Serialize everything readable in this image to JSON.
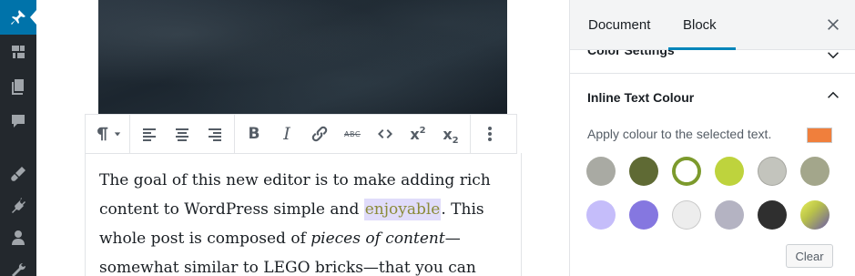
{
  "admin_menu": {
    "items": [
      {
        "icon": "pin-icon",
        "active": true
      },
      {
        "icon": "media-icon",
        "active": false
      },
      {
        "icon": "pages-icon",
        "active": false
      },
      {
        "icon": "comments-icon",
        "active": false
      },
      {
        "icon": "appearance-icon",
        "active": false
      },
      {
        "icon": "plugins-icon",
        "active": false
      },
      {
        "icon": "users-icon",
        "active": false
      },
      {
        "icon": "tools-icon",
        "active": false
      }
    ]
  },
  "toolbar": {
    "paragraph_icon": "paragraph-icon",
    "buttons": [
      "align-left-icon",
      "align-center-icon",
      "align-right-icon",
      "bold-icon",
      "italic-icon",
      "link-icon",
      "strikethrough-icon",
      "code-icon",
      "superscript-icon",
      "subscript-icon",
      "more-icon"
    ],
    "bold_glyph": "B",
    "italic_glyph": "I",
    "strike_glyph": "ABC",
    "sup_glyph": "x",
    "sup_small": "2",
    "sub_glyph": "x",
    "sub_small": "2"
  },
  "content": {
    "line1_a": "The goal of this new editor is to make adding rich content to WordPress simple and ",
    "highlighted": "enjoyable",
    "line1_b": ". This whole post is composed of ",
    "italic": "pieces of content",
    "line1_c": "—somewhat similar to LEGO bricks—that you can"
  },
  "settings": {
    "tab_document": "Document",
    "tab_block": "Block",
    "collapsed_panel_title": "Color Settings",
    "panel_title": "Inline Text Colour",
    "apply_label": "Apply colour to the selected text.",
    "current_color": "#f07f3c",
    "swatches": [
      {
        "color": "#a9aaa3",
        "selected": false
      },
      {
        "color": "#5f6a34",
        "selected": false
      },
      {
        "color": "#7c9a2c",
        "selected": true
      },
      {
        "color": "#bed33d",
        "selected": false
      },
      {
        "color": "#c3c4bd",
        "selected": false
      },
      {
        "color": "#a3a68b",
        "selected": false
      },
      {
        "color": "#c5bdfa",
        "selected": false
      },
      {
        "color": "#8577e0",
        "selected": false
      },
      {
        "color": "#ededed",
        "selected": false
      },
      {
        "color": "#b4b3c2",
        "selected": false
      },
      {
        "color": "#2f2f2f",
        "selected": false
      },
      {
        "color": "gradient-yellow-purple",
        "selected": false
      }
    ],
    "clear_label": "Clear"
  }
}
